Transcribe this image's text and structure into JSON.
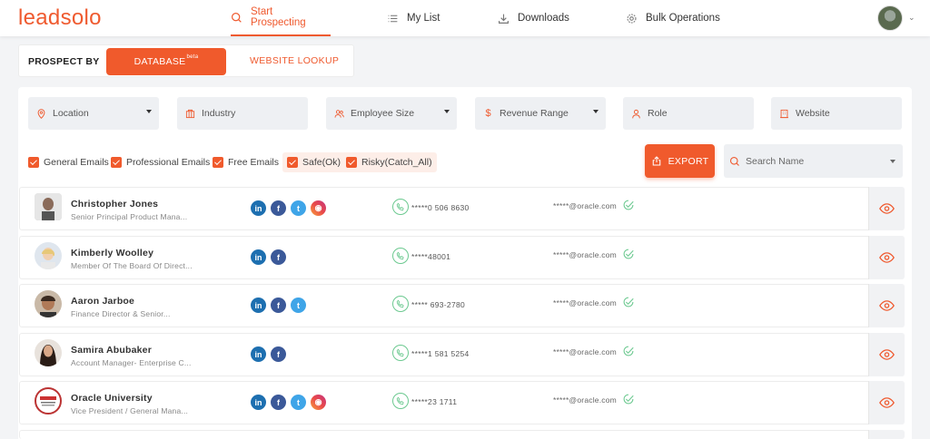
{
  "app": {
    "logo": "leadsolo"
  },
  "nav": {
    "items": [
      {
        "label": "Start Prospecting",
        "icon": "search-icon",
        "active": true
      },
      {
        "label": "My List",
        "icon": "list-icon",
        "active": false
      },
      {
        "label": "Downloads",
        "icon": "download-icon",
        "active": false
      },
      {
        "label": "Bulk Operations",
        "icon": "gear-icon",
        "active": false
      }
    ]
  },
  "prospect": {
    "label": "PROSPECT BY",
    "database": "DATABASE",
    "database_badge": "beta",
    "website_lookup": "WEBSITE LOOKUP"
  },
  "filters": [
    {
      "label": "Location",
      "icon": "location-pin-icon",
      "dropdown": true
    },
    {
      "label": "Industry",
      "icon": "industry-icon",
      "dropdown": false
    },
    {
      "label": "Employee Size",
      "icon": "users-icon",
      "dropdown": true
    },
    {
      "label": "Revenue Range",
      "icon": "dollar-icon",
      "dropdown": true
    },
    {
      "label": "Role",
      "icon": "person-icon",
      "dropdown": false
    },
    {
      "label": "Website",
      "icon": "building-icon",
      "dropdown": false
    }
  ],
  "checkboxes": [
    {
      "label": "General Emails",
      "checked": true
    },
    {
      "label": "Professional Emails",
      "checked": true
    },
    {
      "label": "Free Emails",
      "checked": true
    },
    {
      "label": "Safe(Ok)",
      "checked": true
    },
    {
      "label": "Risky(Catch_All)",
      "checked": true
    }
  ],
  "actions": {
    "export": "EXPORT",
    "search_placeholder": "Search Name"
  },
  "colors": {
    "accent": "#f05a2c",
    "verified": "#6cc990"
  },
  "contacts": [
    {
      "name": "Christopher Jones",
      "title": "Senior Principal Product Mana...",
      "socials": [
        "linkedin",
        "facebook",
        "twitter",
        "instagram"
      ],
      "phone": "*****0 506 8630",
      "email": "*****@oracle.com"
    },
    {
      "name": "Kimberly Woolley",
      "title": "Member Of The Board Of Direct...",
      "socials": [
        "linkedin",
        "facebook"
      ],
      "phone": "*****48001",
      "email": "*****@oracle.com"
    },
    {
      "name": "Aaron Jarboe",
      "title": "Finance Director & Senior...",
      "socials": [
        "linkedin",
        "facebook",
        "twitter"
      ],
      "phone": "***** 693-2780",
      "email": "*****@oracle.com"
    },
    {
      "name": "Samira Abubaker",
      "title": "Account Manager- Enterprise C...",
      "socials": [
        "linkedin",
        "facebook"
      ],
      "phone": "*****1 581 5254",
      "email": "*****@oracle.com"
    },
    {
      "name": "Oracle University",
      "title": "Vice President / General Mana...",
      "socials": [
        "linkedin",
        "facebook",
        "twitter",
        "instagram"
      ],
      "phone": "*****23 1711",
      "email": "*****@oracle.com"
    }
  ]
}
